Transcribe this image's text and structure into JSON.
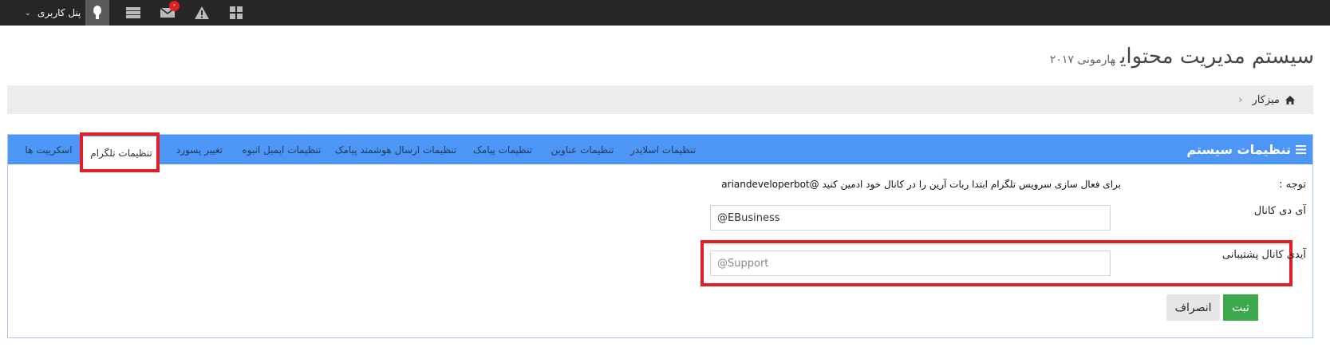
{
  "topbar": {
    "user_panel_label": "پنل کاربری",
    "messages_badge": "۰",
    "icons": [
      "windows-icon",
      "warning-icon",
      "mail-icon",
      "server-icon",
      "user-icon",
      "chevron-down-icon"
    ]
  },
  "header": {
    "title": "سیستم مدیریت محتوای",
    "subtitle": "هارمونی ۲۰۱۷"
  },
  "breadcrumb": {
    "home": "میزکار"
  },
  "panel": {
    "title": "تنظیمات سیستم",
    "tabs": [
      {
        "label": "تنظیمات اسلایدر"
      },
      {
        "label": "تنظیمات عناوین"
      },
      {
        "label": "تنظیمات پیامک"
      },
      {
        "label": "تنظیمات ارسال هوشمند پیامک"
      },
      {
        "label": "تنظیمات ایمیل انبوه"
      },
      {
        "label": "تغییر پسورد"
      },
      {
        "label": "تنظیمات تلگرام"
      },
      {
        "label": "اسکریپت ها"
      }
    ],
    "active_tab": "تنظیمات تلگرام"
  },
  "form": {
    "note_label": "توجه :",
    "note_text": "برای فعال سازی سرویس تلگرام ابتدا ربات آرین را در کانال خود ادمین کنید @ariandeveloperbot",
    "channel_id_label": "آی دی کانال",
    "channel_id_value": "@EBusiness",
    "support_id_label": "آیدی کانال پشتیبانی",
    "support_id_placeholder": "@Support",
    "save_label": "ثبت",
    "cancel_label": "انصراف"
  },
  "colors": {
    "topbar": "#262626",
    "panel_header": "#4d96f5",
    "highlight": "#e41e26",
    "save_button": "#3aa84b"
  }
}
